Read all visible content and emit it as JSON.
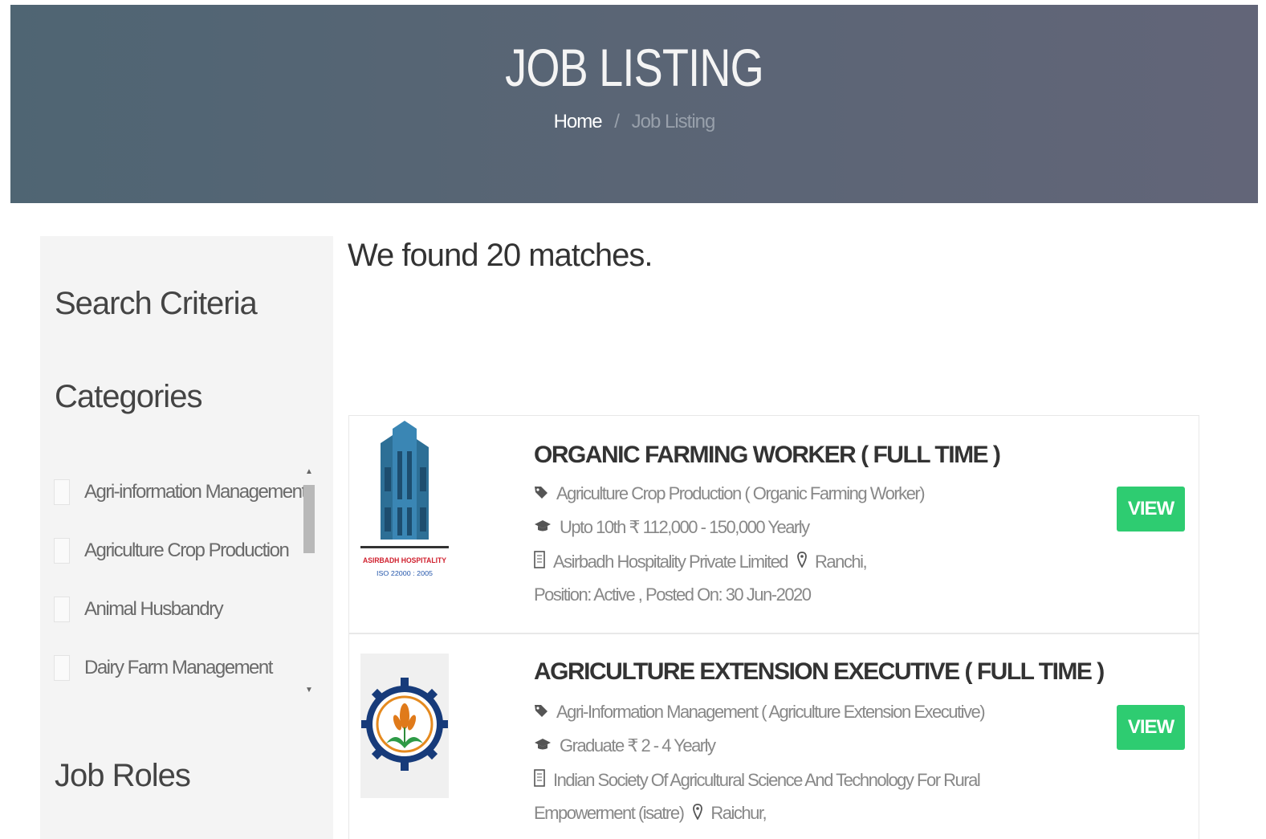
{
  "hero": {
    "title": "JOB LISTING",
    "breadcrumb": {
      "home": "Home",
      "separator": "/",
      "current": "Job Listing"
    }
  },
  "sidebar": {
    "search_criteria": "Search Criteria",
    "categories_heading": "Categories",
    "categories": [
      "Agri-information Management",
      "Agriculture Crop Production",
      "Animal Husbandry",
      "Dairy Farm Management"
    ],
    "job_roles_heading": "Job Roles"
  },
  "results": {
    "count_text": "We found 20 matches."
  },
  "jobs": [
    {
      "title": "ORGANIC FARMING WORKER ( FULL TIME )",
      "category": "Agriculture Crop Production ( Organic Farming Worker)",
      "qualification_salary": "Upto 10th ₹ 112,000 - 150,000 Yearly",
      "company": "Asirbadh Hospitality Private Limited",
      "location": "Ranchi,",
      "status": "Position: Active , Posted On: 30 Jun-2020",
      "button": "VIEW",
      "logo_text": "ASIRBADH HOSPITALITY",
      "logo_subtext": "ISO 22000 : 2005"
    },
    {
      "title": "AGRICULTURE EXTENSION EXECUTIVE ( FULL TIME )",
      "category": "Agri-Information Management ( Agriculture Extension Executive)",
      "qualification_salary": "Graduate ₹ 2 - 4 Yearly",
      "company_line1": "Indian Society Of Agricultural Science And Technology For Rural",
      "company_line2": "Empowerment (isatre)",
      "location": "Raichur,",
      "button": "VIEW"
    }
  ],
  "colors": {
    "hero_start": "#4f6573",
    "hero_end": "#626578",
    "view_button": "#2ecc71",
    "sidebar_bg": "#f4f4f4"
  }
}
